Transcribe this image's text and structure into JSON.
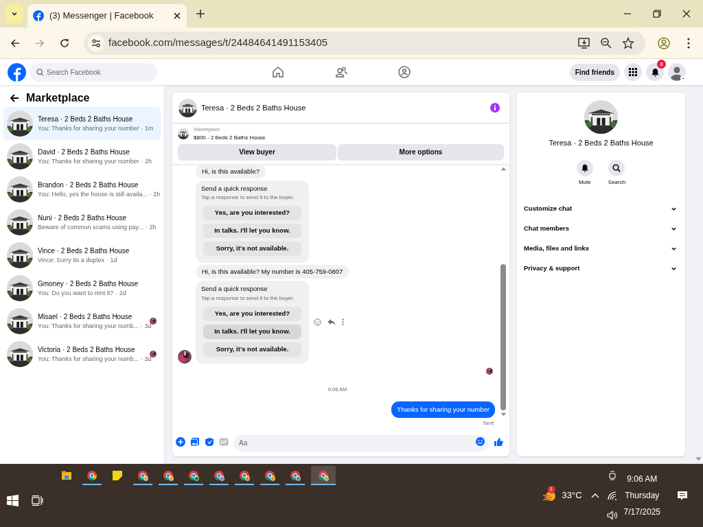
{
  "browser": {
    "tab_title": "(3) Messenger | Facebook",
    "url": "facebook.com/messages/t/24484641491153405"
  },
  "header": {
    "search_placeholder": "Search Facebook",
    "find_friends": "Find friends",
    "notification_count": "3"
  },
  "sidebar": {
    "title": "Marketplace",
    "conversations": [
      {
        "name": "Teresa · 2 Beds 2 Baths House",
        "preview": "You: Thanks for sharing your number",
        "time": "· 1m",
        "selected": true,
        "seen": false
      },
      {
        "name": "David · 2 Beds 2 Baths House",
        "preview": "You: Thanks for sharing your number",
        "time": "· 2h",
        "selected": false,
        "seen": false
      },
      {
        "name": "Brandon · 2 Beds 2 Baths House",
        "preview": "You: Hello, yes the house is still availa...",
        "time": "· 2h",
        "selected": false,
        "seen": false
      },
      {
        "name": "Nuni · 2 Beds 2 Baths House",
        "preview": "Beware of common scams using pay...",
        "time": "· 2h",
        "selected": false,
        "seen": false
      },
      {
        "name": "Vince · 2 Beds 2 Baths House",
        "preview": "Vince: Sorry its a duplex",
        "time": "· 1d",
        "selected": false,
        "seen": false
      },
      {
        "name": "Gmoney · 2 Beds 2 Baths House",
        "preview": "You: Do you want to rent it?",
        "time": "· 2d",
        "selected": false,
        "seen": false
      },
      {
        "name": "Misael · 2 Beds 2 Baths House",
        "preview": "You: Thanks for sharing your numb...",
        "time": "· 3d",
        "selected": false,
        "seen": true
      },
      {
        "name": "Victoria · 2 Beds 2 Baths House",
        "preview": "You: Thanks for sharing your numb...",
        "time": "· 3d",
        "selected": false,
        "seen": true
      }
    ]
  },
  "chat": {
    "title": "Teresa · 2 Beds 2 Baths House",
    "listing_label": "Marketplace",
    "listing": "$800 - 2 Beds 2 Baths House",
    "buttons": [
      "View buyer",
      "More options"
    ],
    "messages": [
      {
        "kind": "incoming",
        "text": "Hi, is this available?"
      },
      {
        "kind": "quick",
        "title": "Send a quick response",
        "subtitle": "Tap a response to send it to the buyer.",
        "avatar": false,
        "hovered": false,
        "options": [
          {
            "label": "Yes, are you interested?",
            "hovered": false
          },
          {
            "label": "In talks. I'll let you know.",
            "hovered": false
          },
          {
            "label": "Sorry, it's not available.",
            "hovered": false
          }
        ]
      },
      {
        "kind": "incoming",
        "text": "Hi, is this available? My number is 405-759-0807"
      },
      {
        "kind": "quick",
        "title": "Send a quick response",
        "subtitle": "Tap a response to send it to the buyer.",
        "avatar": true,
        "hovered": true,
        "options": [
          {
            "label": "Yes, are you interested?",
            "hovered": false
          },
          {
            "label": "In talks. I'll let you know.",
            "hovered": true
          },
          {
            "label": "Sorry, it's not available.",
            "hovered": false
          }
        ]
      },
      {
        "kind": "seen"
      },
      {
        "kind": "time",
        "text": "9:06 AM"
      },
      {
        "kind": "outgoing",
        "text": "Thanks for sharing your number",
        "status": "Sent"
      }
    ],
    "composer_placeholder": "Aa"
  },
  "details": {
    "title": "Teresa · 2 Beds 2 Baths House",
    "actions": [
      "Mute",
      "Search"
    ],
    "sections": [
      "Customize chat",
      "Chat members",
      "Media, files and links",
      "Privacy & support"
    ]
  },
  "taskbar": {
    "weather_badge": "1",
    "temperature": "33°C",
    "time": "9:06 AM",
    "day": "Thursday",
    "date": "7/17/2025"
  }
}
